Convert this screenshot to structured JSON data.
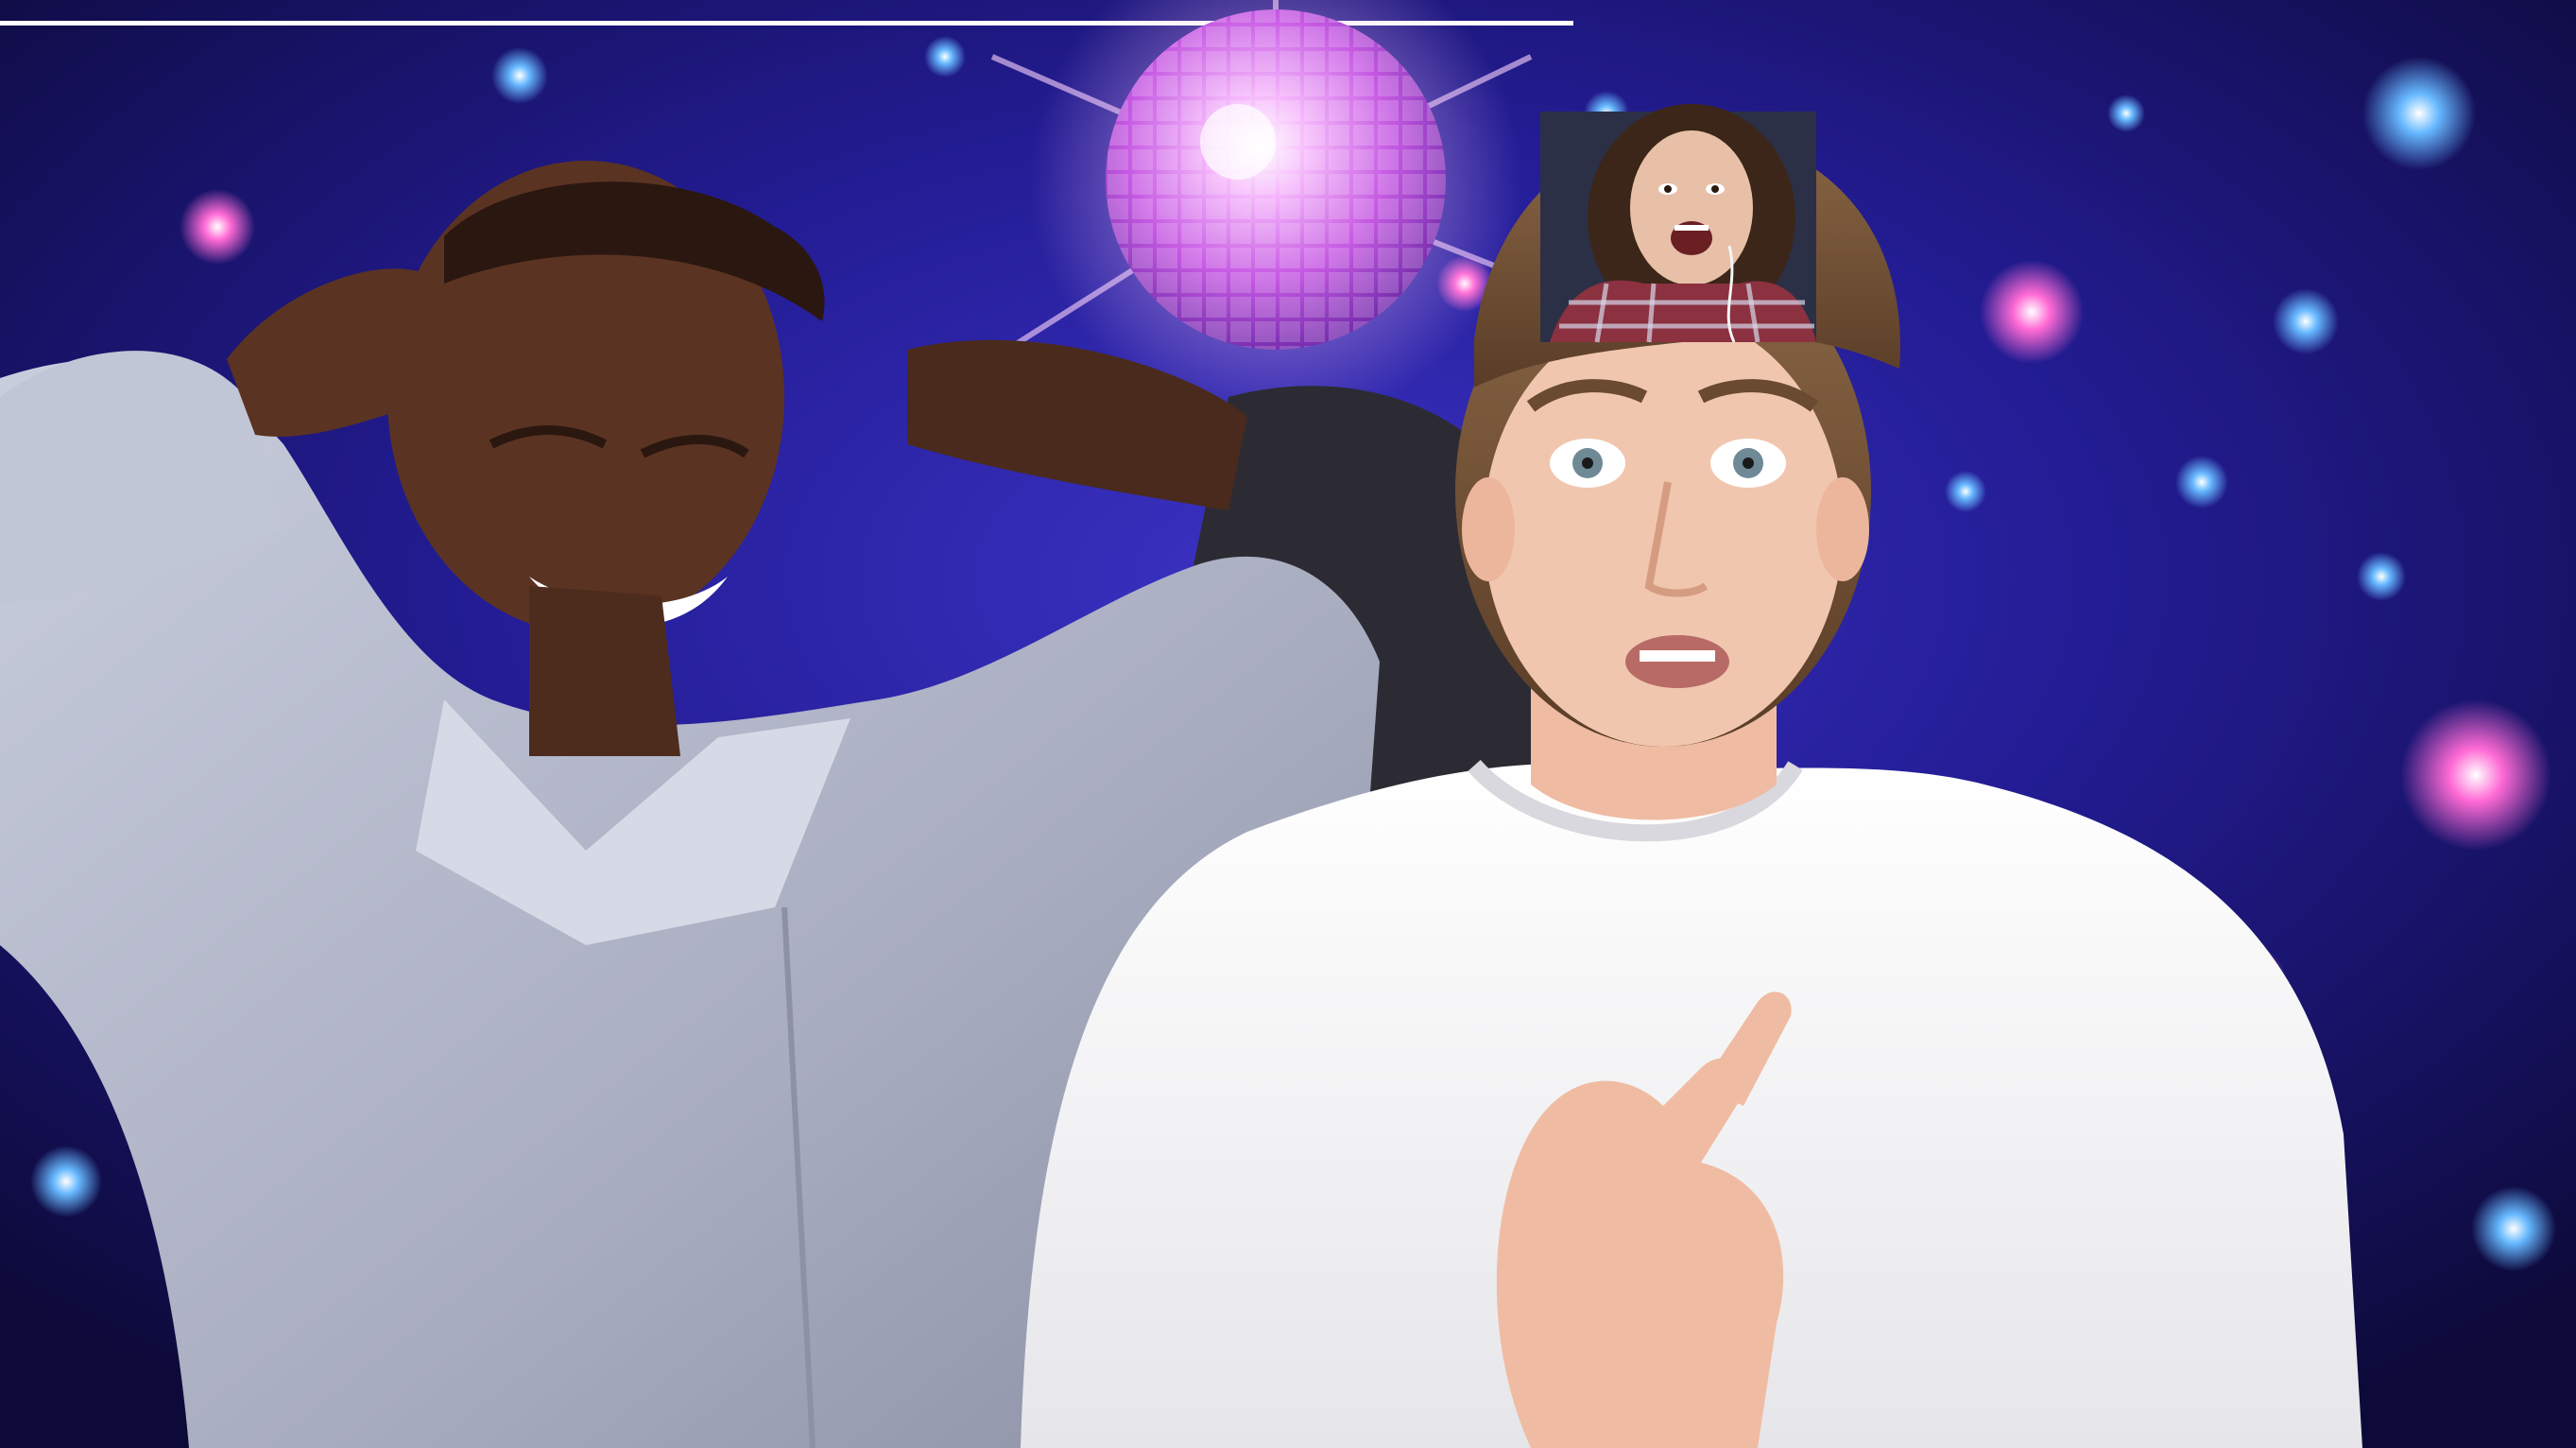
{
  "scene": {
    "kind": "meme-composite",
    "background": "disco-lights",
    "elements": [
      "top-rule",
      "disco-ball",
      "dancing-man",
      "surprised-young-man",
      "webcam-inset"
    ]
  },
  "colors": {
    "bg_deep": "#0f0c3f",
    "bg_mid": "#2a23a8",
    "bg_glow": "#5a4be0",
    "disco_pink": "#e88df2",
    "disco_core": "#ffffff",
    "bokeh_pink": "#ff5fcf",
    "bokeh_blue": "#5fb0ff",
    "bokeh_white": "#f4f0ff",
    "shirt_blue": "#b3b7c9",
    "skin_dark": "#5b3322",
    "skin_light": "#f1c6ae",
    "hair_brown": "#6a4a31",
    "tshirt_white": "#f7f7f7",
    "rule_white": "#ffffff"
  }
}
